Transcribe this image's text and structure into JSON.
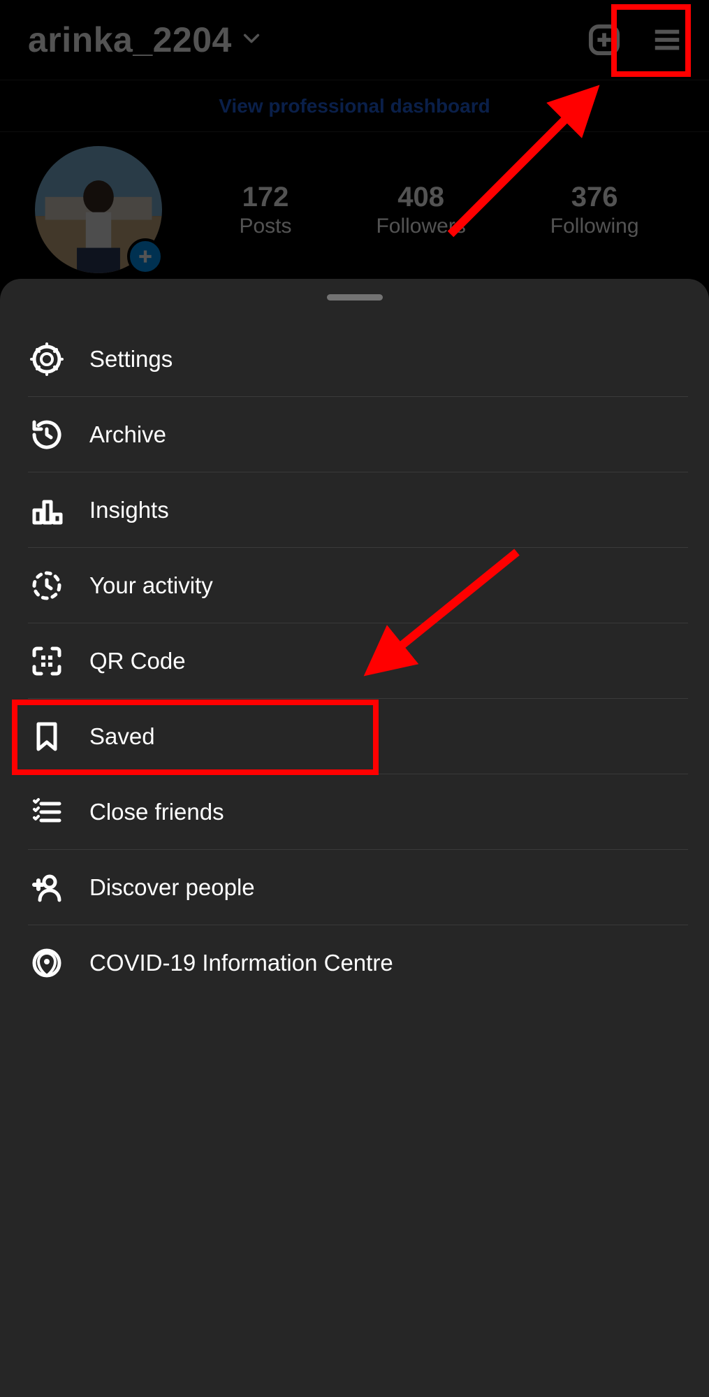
{
  "header": {
    "username": "arinka_2204"
  },
  "dashboard_link": "View professional dashboard",
  "stats": {
    "posts": {
      "value": "172",
      "label": "Posts"
    },
    "followers": {
      "value": "408",
      "label": "Followers"
    },
    "following": {
      "value": "376",
      "label": "Following"
    }
  },
  "menu": {
    "settings": "Settings",
    "archive": "Archive",
    "insights": "Insights",
    "activity": "Your activity",
    "qr": "QR Code",
    "saved": "Saved",
    "close_friends": "Close friends",
    "discover": "Discover people",
    "covid": "COVID-19 Information Centre"
  }
}
